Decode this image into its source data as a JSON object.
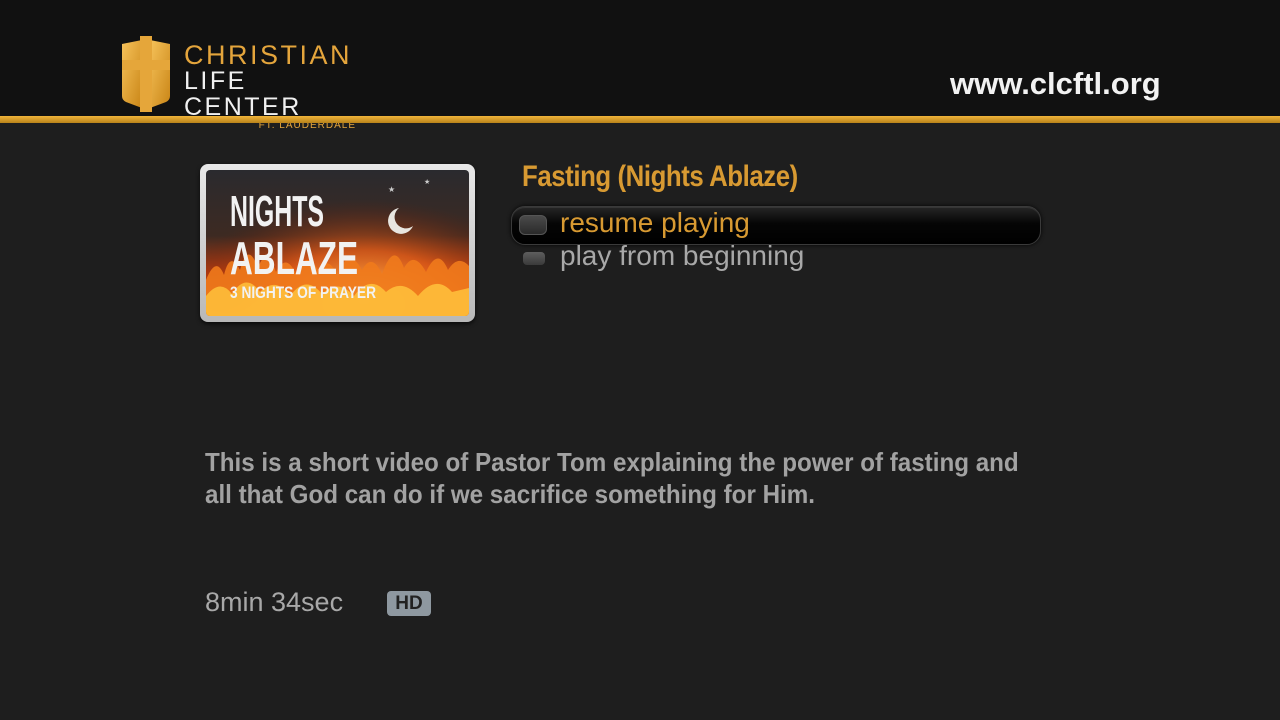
{
  "header": {
    "logo": {
      "line1": "CHRISTIAN",
      "line2_a": "LIFE",
      "line2_b": "CENTER",
      "line3": "FT. LAUDERDALE",
      "icon": "cross-shield-icon"
    },
    "website": "www.clcftl.org"
  },
  "colors": {
    "accent_gold": "#d89a32",
    "header_bg": "#111111",
    "page_bg": "#1e1e1e",
    "text_gray": "#a2a2a2"
  },
  "video": {
    "thumbnail": {
      "line1": "NIGHTS",
      "line2": "ABLAZE",
      "line3": "3 NIGHTS OF PRAYER",
      "icon": "crescent-moon-icon"
    },
    "title": "Fasting (Nights Ablaze)",
    "menu": [
      {
        "label": "resume playing",
        "selected": true
      },
      {
        "label": "play from beginning",
        "selected": false
      }
    ],
    "description": "This is a short video of Pastor Tom explaining the power of fasting and all that God can do if we sacrifice something for Him.",
    "duration": "8min 34sec",
    "quality_badge": "HD"
  }
}
